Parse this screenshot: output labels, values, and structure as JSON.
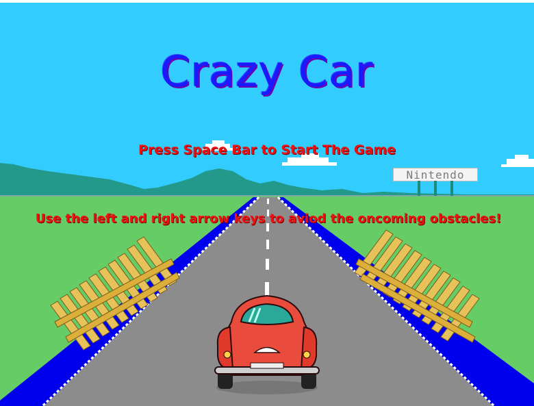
{
  "game": {
    "title": "Crazy Car",
    "start_prompt": "Press Space Bar to Start The Game",
    "instructions": "Use the left and right arrow keys to aviod the oncoming obstacles!",
    "sign_text": "Nintendo"
  },
  "colors": {
    "sky": "#33ccff",
    "grass": "#66cc66",
    "road": "#8c8c8c",
    "road_edge": "#0000ee",
    "mountains": "#22998a",
    "fence": "#e7c15a",
    "car_body": "#e94b3c",
    "text_red": "#ee1111",
    "title_blue": "#1a1aff"
  }
}
